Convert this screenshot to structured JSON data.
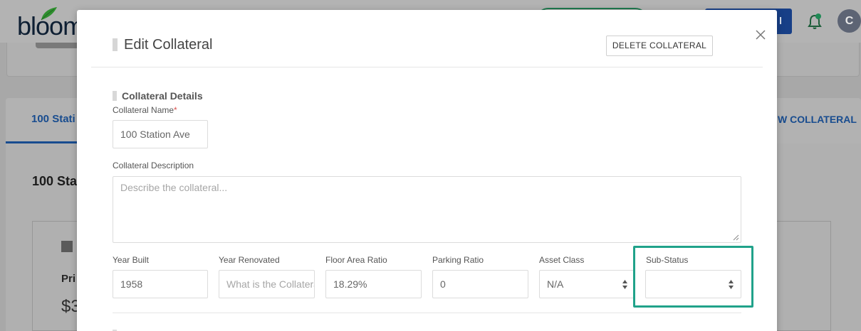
{
  "app": {
    "logo_text": "bloom",
    "avatar_initial": "C",
    "header_button_label": "l",
    "tab_active_label": "100 Stati",
    "new_collateral_label": "W COLLATERAL",
    "section_title": "100 Sta",
    "card_label": "Pri",
    "card_amount": "$3"
  },
  "colors": {
    "brand_navy": "#173f87",
    "accent_green": "#20a28a",
    "required": "#d9534f"
  },
  "modal": {
    "title": "Edit Collateral",
    "delete_button_label": "DELETE COLLATERAL",
    "section_title": "Collateral Details",
    "fields": {
      "collateral_name": {
        "label": "Collateral Name",
        "required_mark": "*",
        "value": "100 Station Ave"
      },
      "collateral_description": {
        "label": "Collateral Description",
        "placeholder": "Describe the collateral..."
      },
      "year_built": {
        "label": "Year Built",
        "value": "1958"
      },
      "year_renovated": {
        "label": "Year Renovated",
        "placeholder": "What is the Collateral"
      },
      "floor_area_ratio": {
        "label": "Floor Area Ratio",
        "value": "18.29%"
      },
      "parking_ratio": {
        "label": "Parking Ratio",
        "value": "0"
      },
      "asset_class": {
        "label": "Asset Class",
        "value": "N/A"
      },
      "sub_status": {
        "label": "Sub-Status",
        "value": ""
      }
    }
  }
}
